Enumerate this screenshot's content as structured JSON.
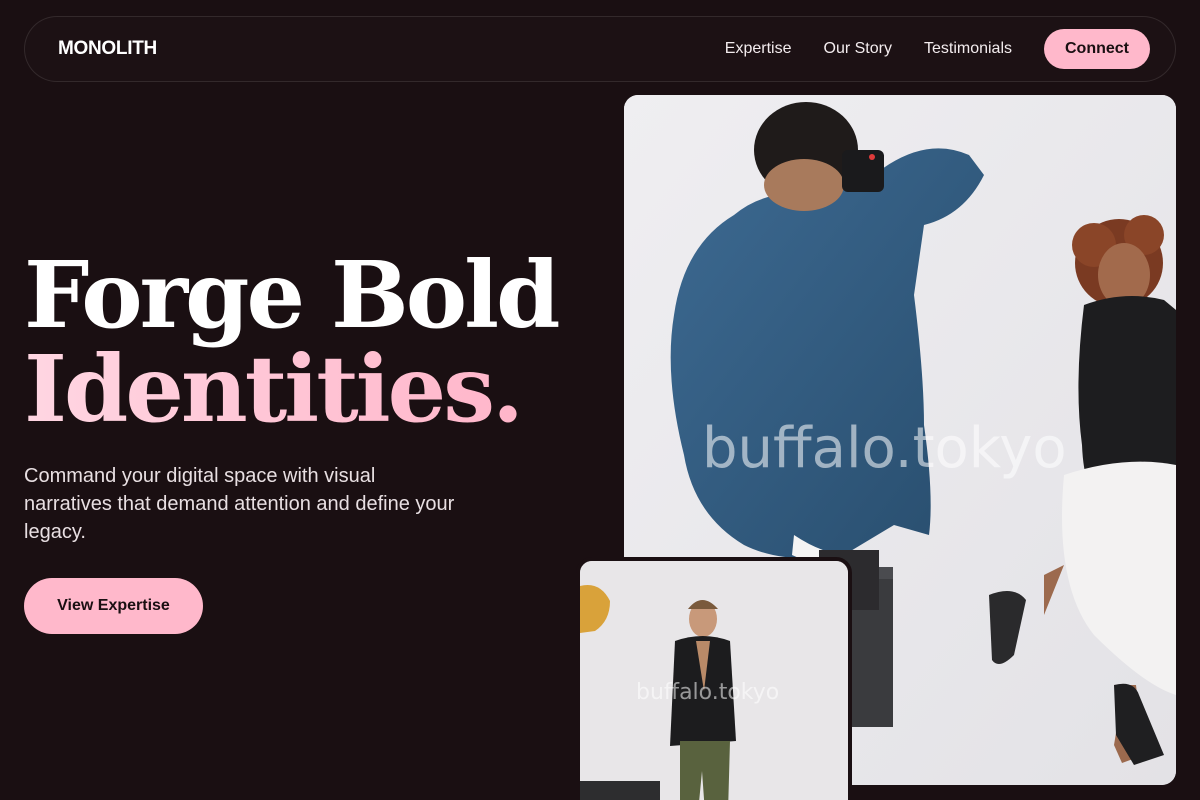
{
  "nav": {
    "brand": "MONOLITH",
    "links": [
      "Expertise",
      "Our Story",
      "Testimonials"
    ],
    "cta": "Connect"
  },
  "hero": {
    "headline_line1": "Forge Bold",
    "headline_line2": "Identities.",
    "lead": "Command your digital space with visual narratives that demand attention and define your legacy.",
    "cta": "View Expertise"
  },
  "photos": {
    "main_watermark": "buffalo.tokyo",
    "small_watermark": "buffalo.tokyo"
  },
  "colors": {
    "background": "#1a0f12",
    "accent": "#ffb8cb",
    "text": "#ffffff"
  }
}
